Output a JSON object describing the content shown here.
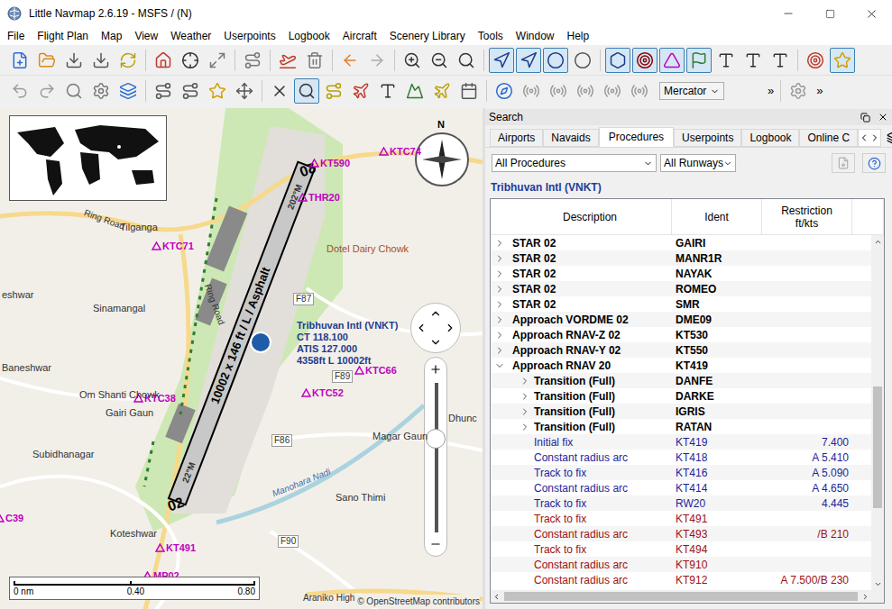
{
  "window": {
    "title": "Little Navmap 2.6.19 - MSFS / (N)"
  },
  "menu": [
    "File",
    "Flight Plan",
    "Map",
    "View",
    "Weather",
    "Userpoints",
    "Logbook",
    "Aircraft",
    "Scenery Library",
    "Tools",
    "Window",
    "Help"
  ],
  "toolbar_1": {
    "buttons": [
      {
        "checked": false
      },
      {
        "checked": false
      },
      {
        "checked": false
      },
      {
        "checked": false
      },
      {
        "checked": false
      },
      {
        "checked": false
      },
      {
        "checked": false
      },
      {
        "checked": false
      },
      {
        "checked": false
      },
      {
        "checked": false
      },
      {
        "checked": false
      },
      {
        "checked": false
      },
      {
        "checked": false
      },
      {
        "checked": false
      },
      {
        "checked": false
      },
      {
        "checked": false
      },
      {
        "checked": true
      },
      {
        "checked": true
      },
      {
        "checked": true
      },
      {
        "checked": false
      },
      {
        "checked": true
      },
      {
        "checked": true
      },
      {
        "checked": true
      },
      {
        "checked": true
      },
      {
        "checked": false
      },
      {
        "checked": false
      },
      {
        "checked": false
      },
      {
        "checked": false
      },
      {
        "checked": true
      }
    ]
  },
  "toolbar_2": {
    "buttons": [
      {
        "checked": false
      },
      {
        "checked": false
      },
      {
        "checked": false
      },
      {
        "checked": false
      },
      {
        "checked": false
      },
      {
        "checked": false
      },
      {
        "checked": false
      },
      {
        "checked": false
      },
      {
        "checked": false
      },
      {
        "checked": false
      },
      {
        "checked": true
      },
      {
        "checked": false
      },
      {
        "checked": false
      },
      {
        "checked": false
      },
      {
        "checked": false
      },
      {
        "checked": false
      },
      {
        "checked": false
      },
      {
        "checked": false
      },
      {
        "checked": false
      },
      {
        "checked": false
      },
      {
        "checked": false
      },
      {
        "checked": false
      },
      {
        "checked": false
      },
      {
        "checked": false
      }
    ],
    "projection": "Mercator",
    "more": [
      "»",
      "»"
    ]
  },
  "map": {
    "compass": "N",
    "airport": {
      "name": "Tribhuvan Intl (VNKT)",
      "lines": [
        "CT 118.100",
        "ATIS 127.000",
        "4358ft L 10002ft"
      ]
    },
    "runway": {
      "label": "10002 x 146 ft / L / Asphalt",
      "heading_top": "202°M",
      "heading_bottom": "22°M",
      "end_top": "20",
      "end_bottom": "02"
    },
    "waypoints": [
      "KTC74",
      "KT590",
      "THR20",
      "KTC71",
      "KTC66",
      "KTC52",
      "KTC38",
      "KT491",
      "MP02",
      "C39"
    ],
    "places": [
      "Tilganga",
      "Sinamangal",
      "eshwar",
      "Baneshwar",
      "Om Shanti Chowk",
      "Gairi Gaun",
      "Subidhanagar",
      "Magar Gaun",
      "Sano Thimi",
      "Koteshwar",
      "Dhunc",
      "Dotel Dairy Chowk"
    ],
    "roads": [
      "F87",
      "F89",
      "F86",
      "F90",
      "Araniko High",
      "Ring Road",
      "Ring Road",
      "Manohara Nadi"
    ],
    "zoom": {
      "level": 0.67
    },
    "scale": [
      "0 nm",
      "0.40",
      "0.80"
    ],
    "attribution": "© OpenStreetMap contributors"
  },
  "panel": {
    "title": "Search",
    "tabs": [
      {
        "label": "Airports",
        "selected": false
      },
      {
        "label": "Navaids",
        "selected": false
      },
      {
        "label": "Procedures",
        "selected": true
      },
      {
        "label": "Userpoints",
        "selected": false
      },
      {
        "label": "Logbook",
        "selected": false
      },
      {
        "label": "Online C",
        "selected": false
      }
    ],
    "filters": {
      "type": "All Procedures",
      "runway": "All Runways"
    },
    "export_disabled": true,
    "airport": "Tribhuvan Intl (VNKT)",
    "columns": [
      [
        "Description"
      ],
      [
        "Ident"
      ],
      [
        "Restriction",
        "ft/kts"
      ]
    ],
    "rows": [
      {
        "kind": "group",
        "expanded": false,
        "description": "STAR 02",
        "ident": "GAIRI",
        "restriction": ""
      },
      {
        "kind": "group",
        "expanded": false,
        "description": "STAR 02",
        "ident": "MANR1R",
        "restriction": ""
      },
      {
        "kind": "group",
        "expanded": false,
        "description": "STAR 02",
        "ident": "NAYAK",
        "restriction": ""
      },
      {
        "kind": "group",
        "expanded": false,
        "description": "STAR 02",
        "ident": "ROMEO",
        "restriction": ""
      },
      {
        "kind": "group",
        "expanded": false,
        "description": "STAR 02",
        "ident": "SMR",
        "restriction": ""
      },
      {
        "kind": "group",
        "expanded": false,
        "description": "Approach VORDME 02",
        "ident": "DME09",
        "restriction": ""
      },
      {
        "kind": "group",
        "expanded": false,
        "description": "Approach RNAV-Z 02",
        "ident": "KT530",
        "restriction": ""
      },
      {
        "kind": "group",
        "expanded": false,
        "description": "Approach RNAV-Y 02",
        "ident": "KT550",
        "restriction": ""
      },
      {
        "kind": "group",
        "expanded": true,
        "description": "Approach RNAV 20",
        "ident": "KT419",
        "restriction": ""
      },
      {
        "kind": "transition",
        "expanded": false,
        "description": "Transition (Full)",
        "ident": "DANFE",
        "restriction": ""
      },
      {
        "kind": "transition",
        "expanded": false,
        "description": "Transition (Full)",
        "ident": "DARKE",
        "restriction": ""
      },
      {
        "kind": "transition",
        "expanded": false,
        "description": "Transition (Full)",
        "ident": "IGRIS",
        "restriction": ""
      },
      {
        "kind": "transition",
        "expanded": false,
        "description": "Transition (Full)",
        "ident": "RATAN",
        "restriction": ""
      },
      {
        "kind": "leg",
        "color": "#1f1f9a",
        "description": "Initial fix",
        "ident": "KT419",
        "restriction": "7.400"
      },
      {
        "kind": "leg",
        "color": "#1f1f9a",
        "description": "Constant radius arc",
        "ident": "KT418",
        "restriction": "A 5.410"
      },
      {
        "kind": "leg",
        "color": "#1f1f9a",
        "description": "Track to fix",
        "ident": "KT416",
        "restriction": "A 5.090"
      },
      {
        "kind": "leg",
        "color": "#1f1f9a",
        "description": "Constant radius arc",
        "ident": "KT414",
        "restriction": "A 4.650"
      },
      {
        "kind": "leg",
        "color": "#1f1f9a",
        "description": "Track to fix",
        "ident": "RW20",
        "restriction": "4.445"
      },
      {
        "kind": "leg",
        "color": "#a01010",
        "description": "Track to fix",
        "ident": "KT491",
        "restriction": ""
      },
      {
        "kind": "leg",
        "color": "#a01010",
        "description": "Constant radius arc",
        "ident": "KT493",
        "restriction": "/B 210"
      },
      {
        "kind": "leg",
        "color": "#a01010",
        "description": "Track to fix",
        "ident": "KT494",
        "restriction": ""
      },
      {
        "kind": "leg",
        "color": "#a01010",
        "description": "Constant radius arc",
        "ident": "KT910",
        "restriction": ""
      },
      {
        "kind": "leg",
        "color": "#a01010",
        "description": "Constant radius arc",
        "ident": "KT912",
        "restriction": "A 7.500/B 230"
      }
    ],
    "vscroll": {
      "level": 0.42,
      "thumb": 0.37
    }
  }
}
